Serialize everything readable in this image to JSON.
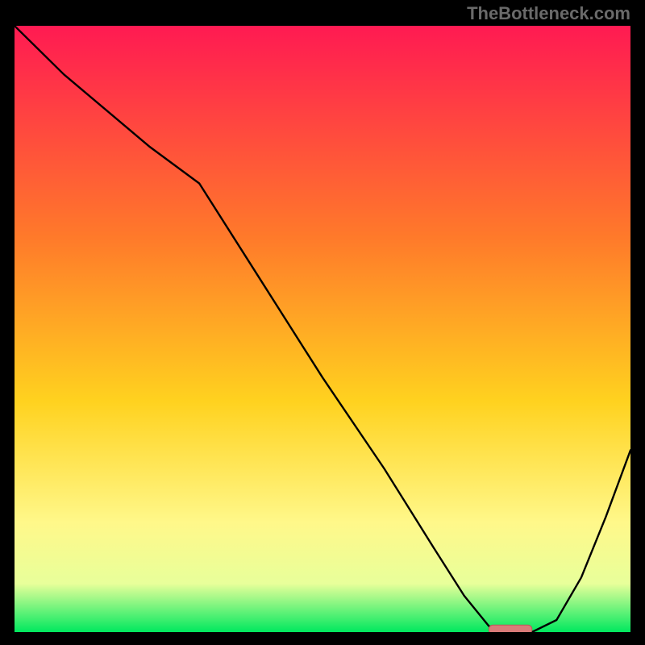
{
  "watermark": "TheBottleneck.com",
  "chart_data": {
    "type": "line",
    "title": "",
    "xlabel": "",
    "ylabel": "",
    "xlim": [
      0,
      100
    ],
    "ylim": [
      0,
      100
    ],
    "x": [
      0,
      8,
      22,
      30,
      40,
      50,
      60,
      68,
      73,
      77,
      80,
      84,
      88,
      92,
      96,
      100
    ],
    "values": [
      100,
      92,
      80,
      74,
      58,
      42,
      27,
      14,
      6,
      1,
      0,
      0,
      2,
      9,
      19,
      30
    ],
    "marker": {
      "x_start": 77,
      "x_end": 84,
      "y": 0.5
    }
  },
  "colors": {
    "gradient_top": "#ff1a52",
    "gradient_mid1": "#ff7a2a",
    "gradient_mid2": "#ffd21f",
    "gradient_mid3": "#fff88a",
    "gradient_mid4": "#e8ff9a",
    "gradient_bottom": "#00e85f",
    "line": "#000000",
    "marker_fill": "#d97b79",
    "marker_stroke": "#b85a58"
  }
}
